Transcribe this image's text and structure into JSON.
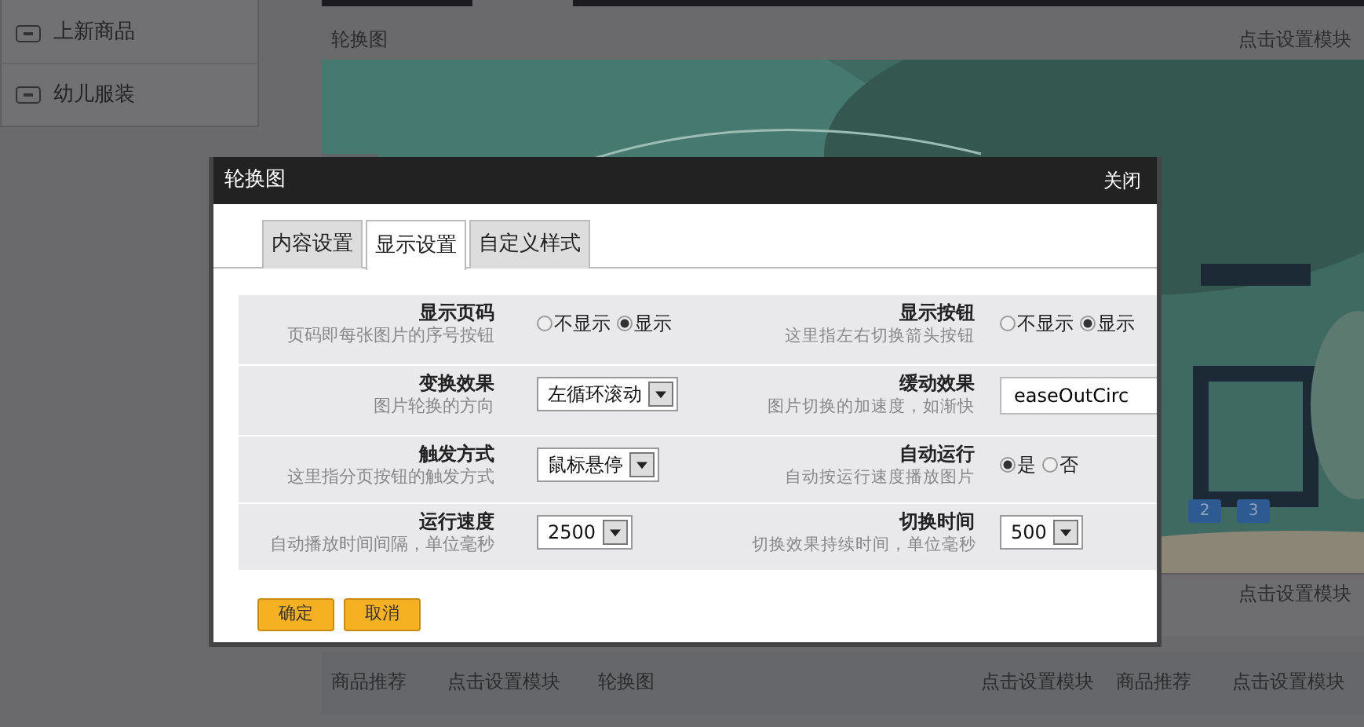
{
  "sidebar": {
    "items": [
      {
        "label": "上新商品"
      },
      {
        "label": "幼儿服装"
      }
    ]
  },
  "carousel_module": {
    "title": "轮换图",
    "action": "点击设置模块",
    "kind": "picture",
    "pager": [
      "2",
      "3"
    ],
    "footer_action": "点击设置模块"
  },
  "bottom_modules": [
    {
      "title": "商品推荐",
      "action": "点击设置模块"
    },
    {
      "title": "轮换图",
      "action": "点击设置模块"
    },
    {
      "title": "商品推荐",
      "action": "点击设置模块"
    }
  ],
  "dialog": {
    "title": "轮换图",
    "close": "关闭",
    "tabs": [
      {
        "label": "内容设置",
        "selected": false
      },
      {
        "label": "显示设置",
        "selected": true
      },
      {
        "label": "自定义样式",
        "selected": false
      }
    ],
    "rows": [
      [
        {
          "label": "显示页码",
          "hint": "页码即每张图片的序号按钮",
          "kind": "radio",
          "options": [
            {
              "label": "不显示",
              "selected": false
            },
            {
              "label": "显示",
              "selected": true
            }
          ]
        },
        {
          "label": "显示按钮",
          "hint": "这里指左右切换箭头按钮",
          "kind": "radio",
          "options": [
            {
              "label": "不显示",
              "selected": false
            },
            {
              "label": "显示",
              "selected": true
            }
          ]
        }
      ],
      [
        {
          "label": "变换效果",
          "hint": "图片轮换的方向",
          "kind": "select",
          "value": "左循环滚动"
        },
        {
          "label": "缓动效果",
          "hint": "图片切换的加速度，如渐快",
          "kind": "text",
          "value": "easeOutCirc"
        }
      ],
      [
        {
          "label": "触发方式",
          "hint": "这里指分页按钮的触发方式",
          "kind": "select",
          "value": "鼠标悬停"
        },
        {
          "label": "自动运行",
          "hint": "自动按运行速度播放图片",
          "kind": "radio",
          "options": [
            {
              "label": "是",
              "selected": true
            },
            {
              "label": "否",
              "selected": false
            }
          ]
        }
      ],
      [
        {
          "label": "运行速度",
          "hint": "自动播放时间间隔，单位毫秒",
          "kind": "select",
          "value": "2500"
        },
        {
          "label": "切换时间",
          "hint": "切换效果持续时间，单位毫秒",
          "kind": "select",
          "value": "500"
        }
      ]
    ],
    "buttons": [
      "确定",
      "取消"
    ]
  }
}
